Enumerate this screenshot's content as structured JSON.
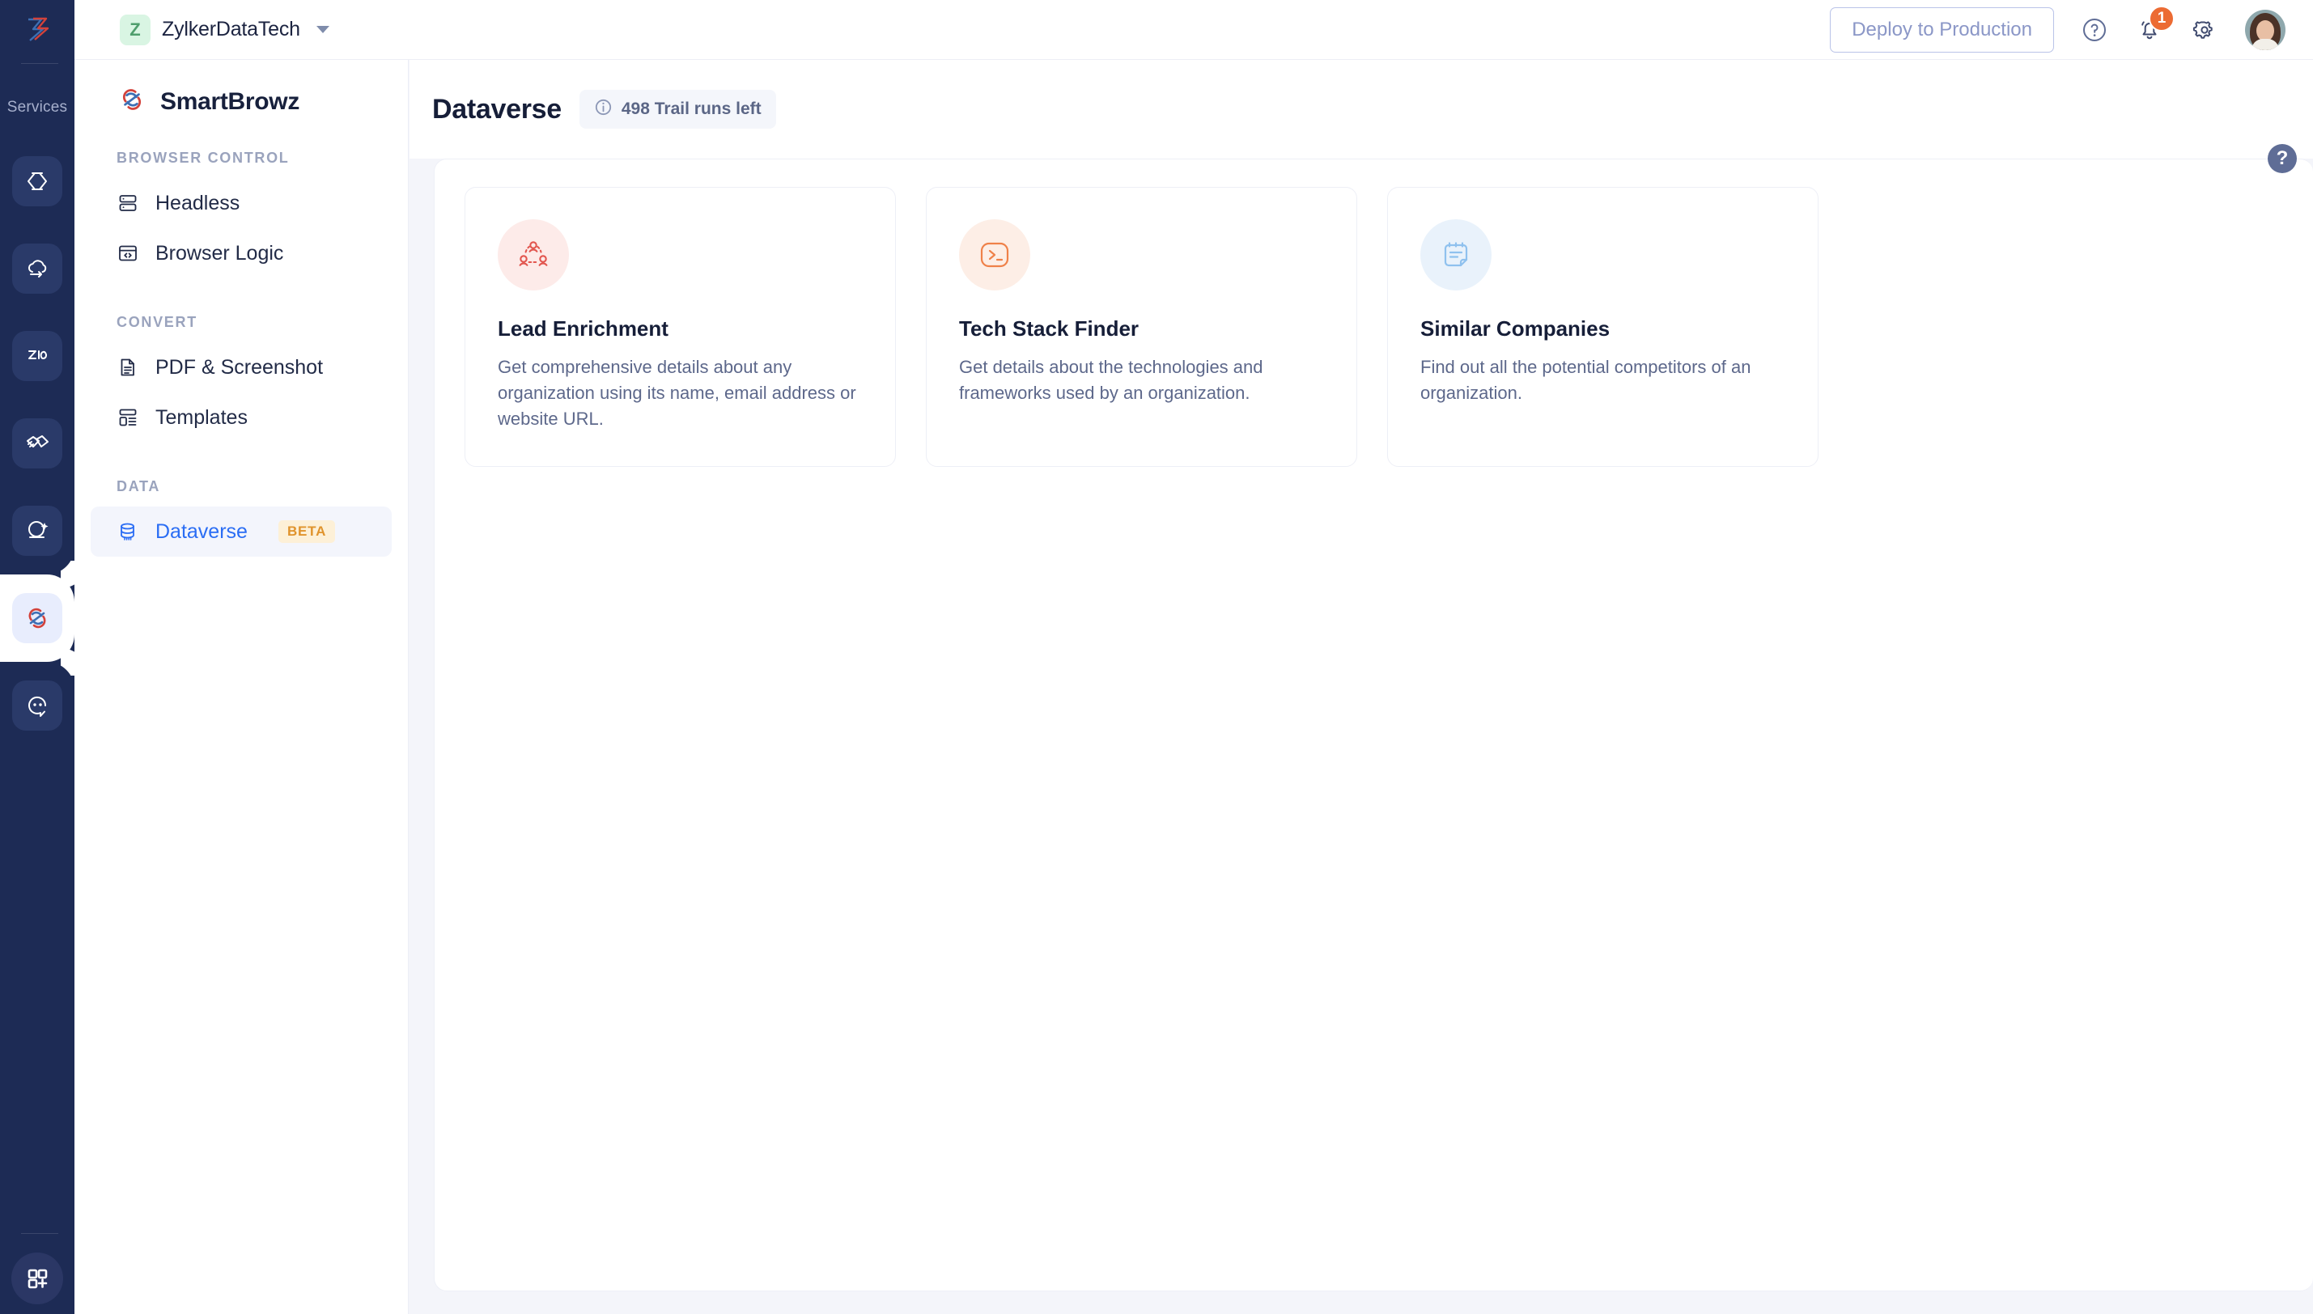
{
  "rail": {
    "logo_icon": "zoho-logo-icon",
    "label": "Services",
    "items": [
      {
        "icon": "code-brackets-icon",
        "name": "catalyst-service",
        "active": false
      },
      {
        "icon": "cloud-arrow-icon",
        "name": "cloud-scale-service",
        "active": false
      },
      {
        "icon": "zia-icon",
        "name": "zia-service",
        "active": false
      },
      {
        "icon": "handshake-icon",
        "name": "connections-service",
        "active": false
      },
      {
        "icon": "crystal-ball-sparkle-icon",
        "name": "quickml-service",
        "active": false
      },
      {
        "icon": "smartbrowz-icon",
        "name": "smartbrowz-service",
        "active": true
      },
      {
        "icon": "chat-bubble-eyes-icon",
        "name": "chat-service",
        "active": false
      }
    ],
    "bottom_icon": "grid-plus-icon"
  },
  "topbar": {
    "org_initial": "Z",
    "org_name": "ZylkerDataTech",
    "org_caret_icon": "chevron-down-icon",
    "deploy_label": "Deploy to Production",
    "help_icon": "question-circle-icon",
    "notifications_icon": "bell-icon",
    "notifications_count": "1",
    "settings_icon": "gear-icon",
    "avatar_icon": "user-avatar"
  },
  "sidebar": {
    "brand_name": "SmartBrowz",
    "brand_icon": "smartbrowz-logo-icon",
    "groups": [
      {
        "title": "BROWSER CONTROL",
        "items": [
          {
            "label": "Headless",
            "icon": "server-stack-icon",
            "active": false
          },
          {
            "label": "Browser Logic",
            "icon": "browser-code-icon",
            "active": false
          }
        ]
      },
      {
        "title": "CONVERT",
        "items": [
          {
            "label": "PDF & Screenshot",
            "icon": "document-lines-icon",
            "active": false
          },
          {
            "label": "Templates",
            "icon": "layout-template-icon",
            "active": false
          }
        ]
      },
      {
        "title": "DATA",
        "items": [
          {
            "label": "Dataverse",
            "icon": "database-api-icon",
            "active": true,
            "badge": "BETA"
          }
        ]
      }
    ]
  },
  "page": {
    "title": "Dataverse",
    "trail_info_icon": "info-circle-icon",
    "trail_text": "498 Trail runs left",
    "help_fab_icon": "question-mark-icon",
    "help_fab_label": "?"
  },
  "cards": [
    {
      "title": "Lead Enrichment",
      "desc": "Get comprehensive details about any organization using its name, email address or website URL.",
      "icon": "people-network-icon",
      "icon_color": "#e2564f",
      "icon_bg": "#fdebe9"
    },
    {
      "title": "Tech Stack Finder",
      "desc": "Get details about the technologies and frameworks used by an organization.",
      "icon": "terminal-prompt-icon",
      "icon_color": "#ef8149",
      "icon_bg": "#fdeee6"
    },
    {
      "title": "Similar Companies",
      "desc": "Find out all the potential competitors of an organization.",
      "icon": "note-document-icon",
      "icon_color": "#8fc1ee",
      "icon_bg": "#e9f2fb"
    }
  ],
  "colors": {
    "rail_bg": "#1d2b55",
    "accent_blue": "#2a6df4",
    "badge_orange": "#ec6b33",
    "beta_amber": "#e0932c",
    "page_bg": "#f4f5fa"
  }
}
